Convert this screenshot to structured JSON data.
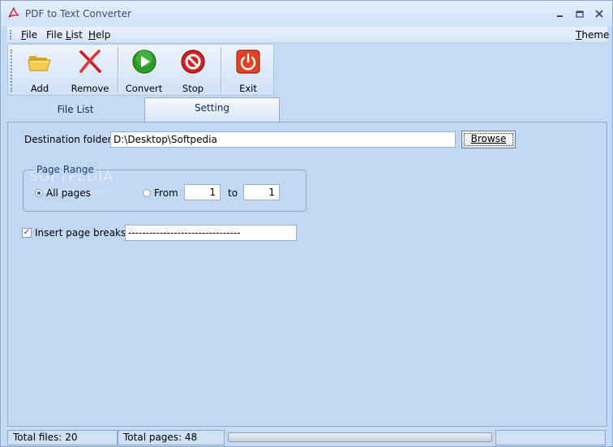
{
  "window": {
    "title": "PDF to Text Converter",
    "icons": {
      "app": "pdf-icon",
      "minimize": "minimize-icon",
      "maximize": "maximize-icon",
      "close": "close-icon"
    }
  },
  "menu": {
    "file": {
      "first": "F",
      "rest": "ile"
    },
    "file_list": {
      "pre": "File ",
      "ul": "L",
      "rest": "ist"
    },
    "help": {
      "first": "H",
      "rest": "elp"
    },
    "theme": {
      "first": "T",
      "rest": "heme"
    }
  },
  "toolbar": {
    "add": {
      "label": "Add",
      "icon": "folder-icon"
    },
    "remove": {
      "label": "Remove",
      "icon": "red-x-icon"
    },
    "convert": {
      "label": "Convert",
      "icon": "play-icon"
    },
    "stop": {
      "label": "Stop",
      "icon": "stop-icon"
    },
    "exit": {
      "label": "Exit",
      "icon": "power-icon"
    }
  },
  "tabs": {
    "file_list": "File List",
    "setting": "Setting"
  },
  "settings": {
    "destination_label": "Destination folder:",
    "destination_value": "D:\\Desktop\\Softpedia",
    "browse_label": "Browse",
    "page_range_title": "Page Range",
    "all_pages_label": "All pages",
    "all_pages_selected": true,
    "from_label": "From",
    "from_value": "1",
    "to_label": "to",
    "to_value": "1",
    "insert_breaks_label": "Insert page breaks:",
    "insert_breaks_checked": true,
    "page_break_value": "--------------------------------"
  },
  "watermark": {
    "text": "SOFTPEDIA",
    "sub": "www.softpedia.com"
  },
  "status": {
    "total_files": "Total files: 20",
    "total_pages": "Total pages: 48",
    "progress": 0
  },
  "colors": {
    "accent": "#1c3f72",
    "convert_green": "#2e9a2a",
    "stop_red": "#d32020",
    "exit_red": "#e04224"
  }
}
